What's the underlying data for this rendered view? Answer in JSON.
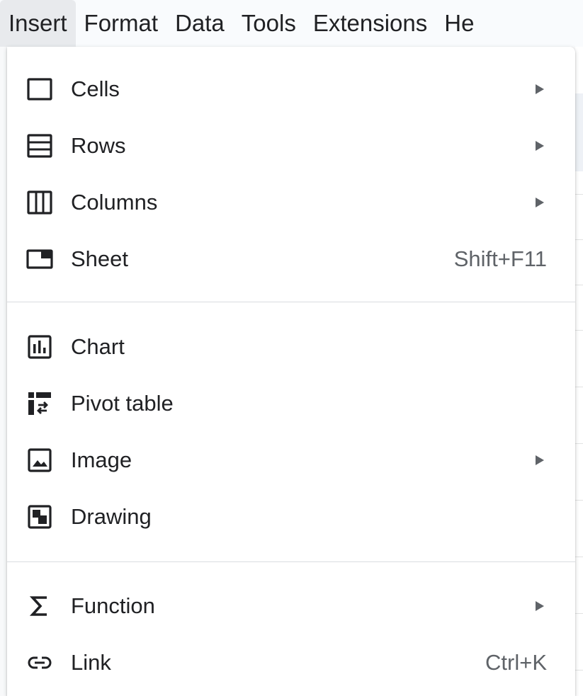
{
  "menubar": {
    "items": [
      {
        "label": "Insert"
      },
      {
        "label": "Format"
      },
      {
        "label": "Data"
      },
      {
        "label": "Tools"
      },
      {
        "label": "Extensions"
      },
      {
        "label": "He"
      }
    ]
  },
  "menu": {
    "items": [
      {
        "label": "Cells",
        "icon": "cells-icon",
        "submenu": true
      },
      {
        "label": "Rows",
        "icon": "rows-icon",
        "submenu": true
      },
      {
        "label": "Columns",
        "icon": "columns-icon",
        "submenu": true
      },
      {
        "label": "Sheet",
        "icon": "sheet-icon",
        "shortcut": "Shift+F11"
      },
      {
        "label": "Chart",
        "icon": "chart-icon"
      },
      {
        "label": "Pivot table",
        "icon": "pivot-table-icon"
      },
      {
        "label": "Image",
        "icon": "image-icon",
        "submenu": true
      },
      {
        "label": "Drawing",
        "icon": "drawing-icon"
      },
      {
        "label": "Function",
        "icon": "sigma-icon",
        "submenu": true
      },
      {
        "label": "Link",
        "icon": "link-icon",
        "shortcut": "Ctrl+K"
      }
    ]
  },
  "colors": {
    "text": "#202124",
    "secondary": "#5f6368",
    "divider": "#dadce0",
    "menubar_bg": "#f9fbfd",
    "active_menu_bg": "#e8eaed"
  }
}
